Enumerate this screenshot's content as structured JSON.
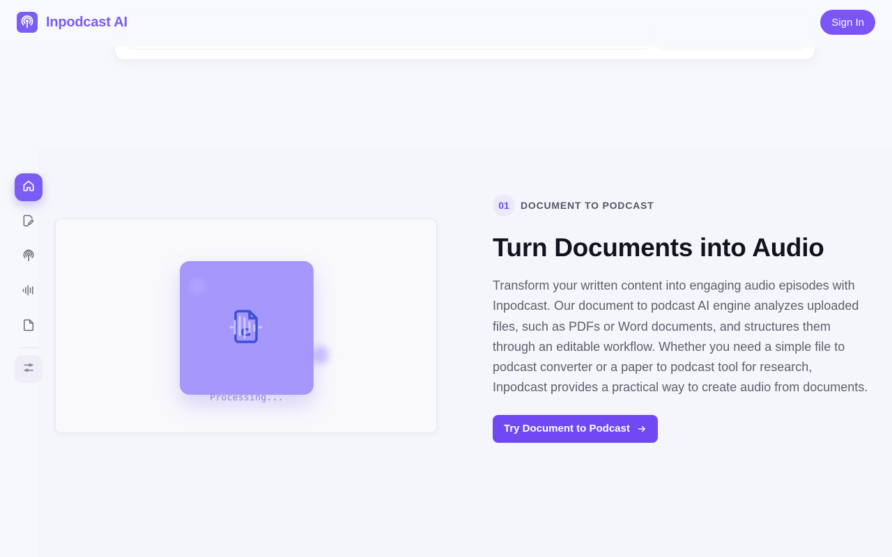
{
  "header": {
    "brand": "Inpodcast AI",
    "signin_label": "Sign In"
  },
  "rail": {
    "items": [
      {
        "icon": "home-icon",
        "active": true
      },
      {
        "icon": "edit-document-icon",
        "active": false
      },
      {
        "icon": "podcast-icon",
        "active": false
      },
      {
        "icon": "waveform-icon",
        "active": false
      },
      {
        "icon": "file-icon",
        "active": false
      },
      {
        "icon": "sliders-icon",
        "active": false
      }
    ]
  },
  "visual": {
    "status": "Processing..."
  },
  "feature": {
    "step": "01",
    "eyebrow": "DOCUMENT TO PODCAST",
    "title": "Turn Documents into Audio",
    "description": "Transform your written content into engaging audio episodes with Inpodcast. Our document to podcast AI engine analyzes uploaded files, such as PDFs or Word documents, and structures them through an editable workflow. Whether you need a simple file to podcast converter or a paper to podcast tool for research, Inpodcast provides a practical way to create audio from documents.",
    "cta_label": "Try Document to Podcast"
  },
  "colors": {
    "accent": "#7b5cf5",
    "button": "#7048f4",
    "tile": "#a597fb"
  }
}
